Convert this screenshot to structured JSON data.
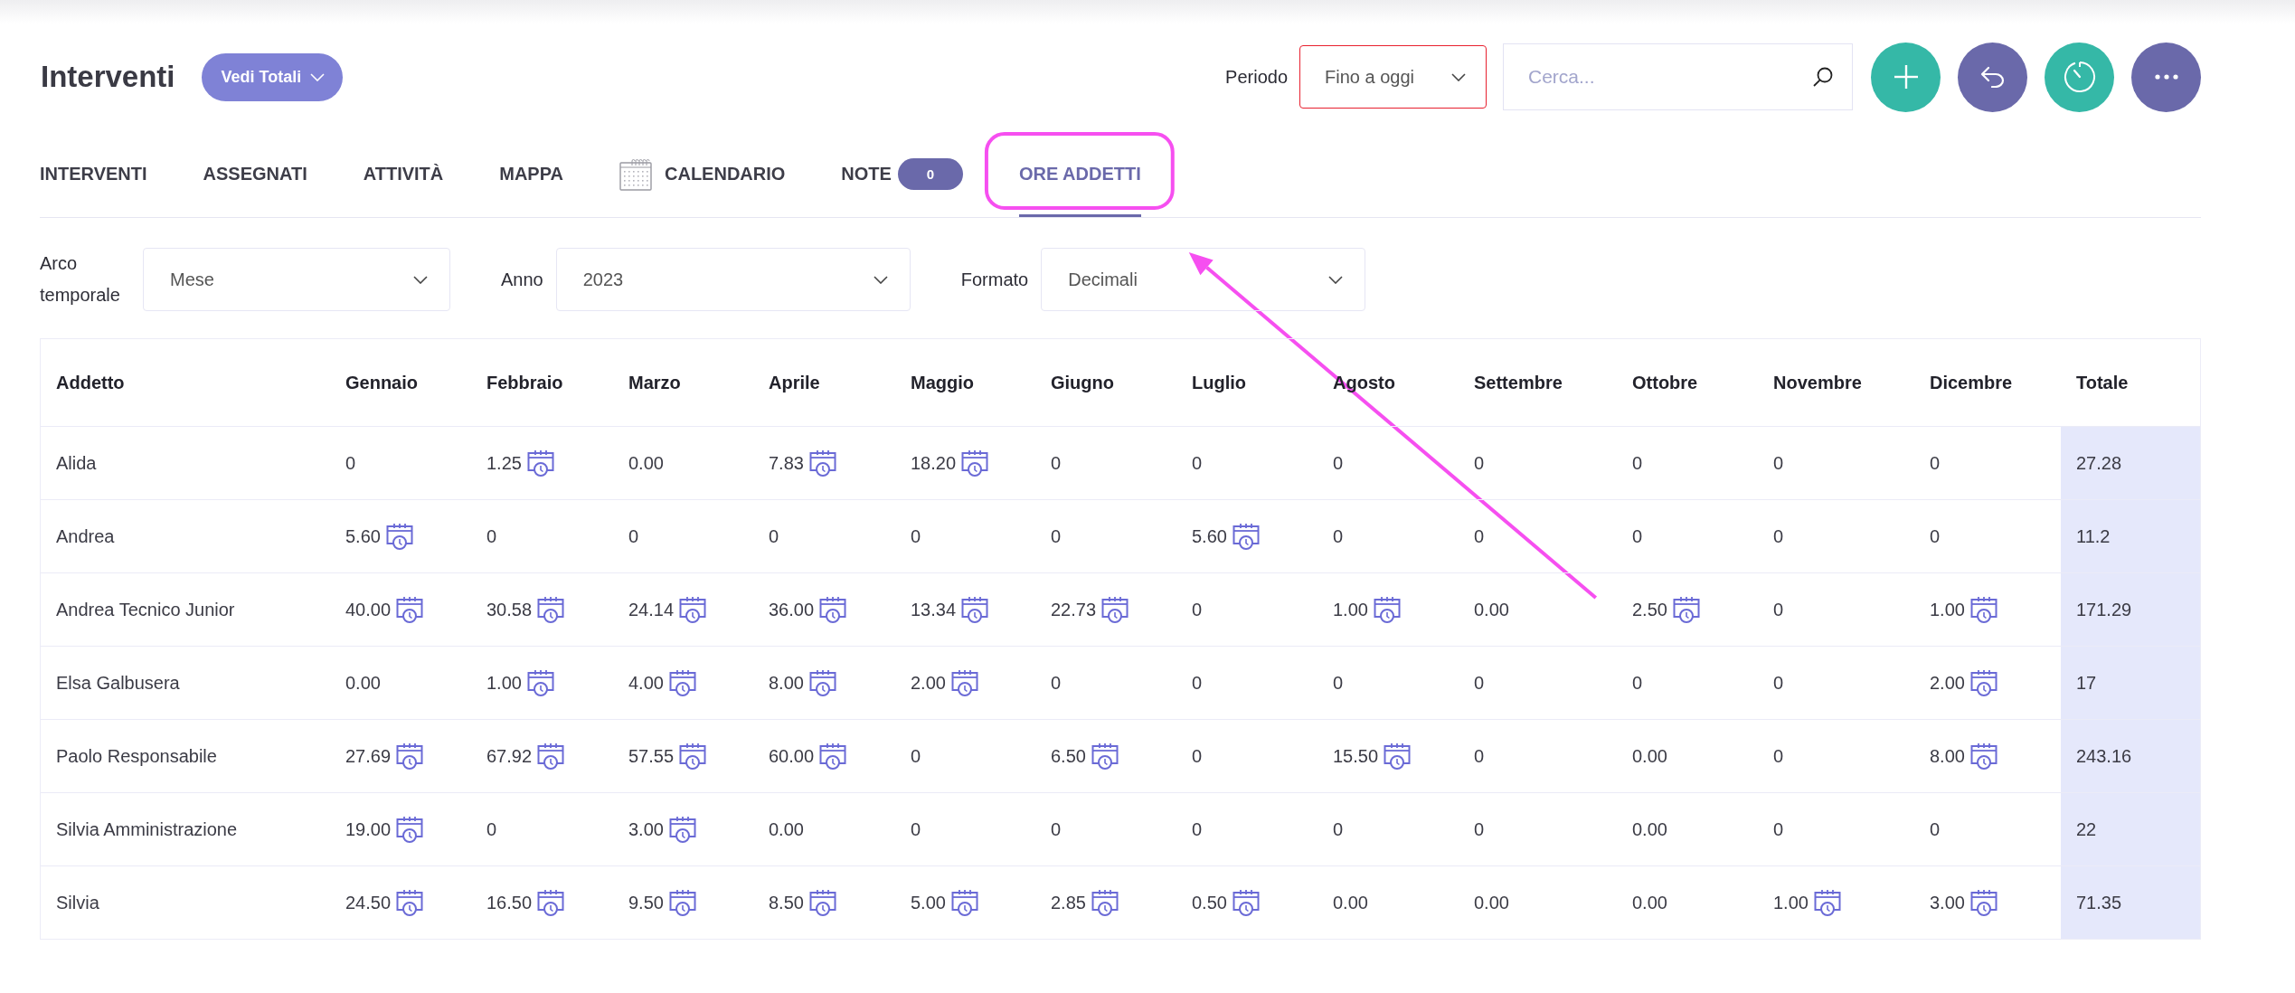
{
  "header": {
    "title": "Interventi",
    "totals_button": "Vedi Totali"
  },
  "toolbar": {
    "period_label": "Periodo",
    "period": {
      "value": "Fino a oggi",
      "error": true
    },
    "search": {
      "placeholder": "Cerca..."
    }
  },
  "tabs": [
    {
      "label": "INTERVENTI",
      "kind": "plain",
      "selected": false,
      "highlighted": false
    },
    {
      "label": "ASSEGNATI",
      "kind": "plain",
      "selected": false,
      "highlighted": false
    },
    {
      "label": "ATTIVITÀ",
      "kind": "plain",
      "selected": false,
      "highlighted": false
    },
    {
      "label": "MAPPA",
      "kind": "plain",
      "selected": false,
      "highlighted": false
    },
    {
      "label": "CALENDARIO",
      "kind": "icon",
      "selected": false,
      "highlighted": false
    },
    {
      "label": "NOTE",
      "kind": "count",
      "badge": "0",
      "selected": false,
      "highlighted": false
    },
    {
      "label": "ORE ADDETTI",
      "kind": "plain",
      "selected": true,
      "highlighted": true
    }
  ],
  "filters": [
    {
      "label": "Arco temporale",
      "value": "Mese"
    },
    {
      "label": "Anno",
      "value": "2023"
    },
    {
      "label": "Formato",
      "value": "Decimali"
    }
  ],
  "table": {
    "columns": [
      "Addetto",
      "Gennaio",
      "Febbraio",
      "Marzo",
      "Aprile",
      "Maggio",
      "Giugno",
      "Luglio",
      "Agosto",
      "Settembre",
      "Ottobre",
      "Novembre",
      "Dicembre",
      "Totale"
    ],
    "rows": [
      {
        "cells": [
          {
            "value": "Alida",
            "has_entries": false
          },
          {
            "value": "0",
            "has_entries": false
          },
          {
            "value": "1.25",
            "has_entries": true
          },
          {
            "value": "0.00",
            "has_entries": false
          },
          {
            "value": "7.83",
            "has_entries": true
          },
          {
            "value": "18.20",
            "has_entries": true
          },
          {
            "value": "0",
            "has_entries": false
          },
          {
            "value": "0",
            "has_entries": false
          },
          {
            "value": "0",
            "has_entries": false
          },
          {
            "value": "0",
            "has_entries": false
          },
          {
            "value": "0",
            "has_entries": false
          },
          {
            "value": "0",
            "has_entries": false
          },
          {
            "value": "0",
            "has_entries": false
          },
          {
            "value": "27.28",
            "has_entries": false
          }
        ]
      },
      {
        "cells": [
          {
            "value": "Andrea",
            "has_entries": false
          },
          {
            "value": "5.60",
            "has_entries": true
          },
          {
            "value": "0",
            "has_entries": false
          },
          {
            "value": "0",
            "has_entries": false
          },
          {
            "value": "0",
            "has_entries": false
          },
          {
            "value": "0",
            "has_entries": false
          },
          {
            "value": "0",
            "has_entries": false
          },
          {
            "value": "5.60",
            "has_entries": true
          },
          {
            "value": "0",
            "has_entries": false
          },
          {
            "value": "0",
            "has_entries": false
          },
          {
            "value": "0",
            "has_entries": false
          },
          {
            "value": "0",
            "has_entries": false
          },
          {
            "value": "0",
            "has_entries": false
          },
          {
            "value": "11.2",
            "has_entries": false
          }
        ]
      },
      {
        "cells": [
          {
            "value": "Andrea Tecnico Junior",
            "has_entries": false
          },
          {
            "value": "40.00",
            "has_entries": true
          },
          {
            "value": "30.58",
            "has_entries": true
          },
          {
            "value": "24.14",
            "has_entries": true
          },
          {
            "value": "36.00",
            "has_entries": true
          },
          {
            "value": "13.34",
            "has_entries": true
          },
          {
            "value": "22.73",
            "has_entries": true
          },
          {
            "value": "0",
            "has_entries": false
          },
          {
            "value": "1.00",
            "has_entries": true
          },
          {
            "value": "0.00",
            "has_entries": false
          },
          {
            "value": "2.50",
            "has_entries": true
          },
          {
            "value": "0",
            "has_entries": false
          },
          {
            "value": "1.00",
            "has_entries": true
          },
          {
            "value": "171.29",
            "has_entries": false
          }
        ]
      },
      {
        "cells": [
          {
            "value": "Elsa Galbusera",
            "has_entries": false
          },
          {
            "value": "0.00",
            "has_entries": false
          },
          {
            "value": "1.00",
            "has_entries": true
          },
          {
            "value": "4.00",
            "has_entries": true
          },
          {
            "value": "8.00",
            "has_entries": true
          },
          {
            "value": "2.00",
            "has_entries": true
          },
          {
            "value": "0",
            "has_entries": false
          },
          {
            "value": "0",
            "has_entries": false
          },
          {
            "value": "0",
            "has_entries": false
          },
          {
            "value": "0",
            "has_entries": false
          },
          {
            "value": "0",
            "has_entries": false
          },
          {
            "value": "0",
            "has_entries": false
          },
          {
            "value": "2.00",
            "has_entries": true
          },
          {
            "value": "17",
            "has_entries": false
          }
        ]
      },
      {
        "cells": [
          {
            "value": "Paolo Responsabile",
            "has_entries": false
          },
          {
            "value": "27.69",
            "has_entries": true
          },
          {
            "value": "67.92",
            "has_entries": true
          },
          {
            "value": "57.55",
            "has_entries": true
          },
          {
            "value": "60.00",
            "has_entries": true
          },
          {
            "value": "0",
            "has_entries": false
          },
          {
            "value": "6.50",
            "has_entries": true
          },
          {
            "value": "0",
            "has_entries": false
          },
          {
            "value": "15.50",
            "has_entries": true
          },
          {
            "value": "0",
            "has_entries": false
          },
          {
            "value": "0.00",
            "has_entries": false
          },
          {
            "value": "0",
            "has_entries": false
          },
          {
            "value": "8.00",
            "has_entries": true
          },
          {
            "value": "243.16",
            "has_entries": false
          }
        ]
      },
      {
        "cells": [
          {
            "value": "Silvia Amministrazione",
            "has_entries": false
          },
          {
            "value": "19.00",
            "has_entries": true
          },
          {
            "value": "0",
            "has_entries": false
          },
          {
            "value": "3.00",
            "has_entries": true
          },
          {
            "value": "0.00",
            "has_entries": false
          },
          {
            "value": "0",
            "has_entries": false
          },
          {
            "value": "0",
            "has_entries": false
          },
          {
            "value": "0",
            "has_entries": false
          },
          {
            "value": "0",
            "has_entries": false
          },
          {
            "value": "0",
            "has_entries": false
          },
          {
            "value": "0.00",
            "has_entries": false
          },
          {
            "value": "0",
            "has_entries": false
          },
          {
            "value": "0",
            "has_entries": false
          },
          {
            "value": "22",
            "has_entries": false
          }
        ]
      },
      {
        "cells": [
          {
            "value": "Silvia",
            "has_entries": false
          },
          {
            "value": "24.50",
            "has_entries": true
          },
          {
            "value": "16.50",
            "has_entries": true
          },
          {
            "value": "9.50",
            "has_entries": true
          },
          {
            "value": "8.50",
            "has_entries": true
          },
          {
            "value": "5.00",
            "has_entries": true
          },
          {
            "value": "2.85",
            "has_entries": true
          },
          {
            "value": "0.50",
            "has_entries": true
          },
          {
            "value": "0.00",
            "has_entries": false
          },
          {
            "value": "0.00",
            "has_entries": false
          },
          {
            "value": "0.00",
            "has_entries": false
          },
          {
            "value": "1.00",
            "has_entries": true
          },
          {
            "value": "3.00",
            "has_entries": true
          },
          {
            "value": "71.35",
            "has_entries": false
          }
        ]
      }
    ]
  }
}
